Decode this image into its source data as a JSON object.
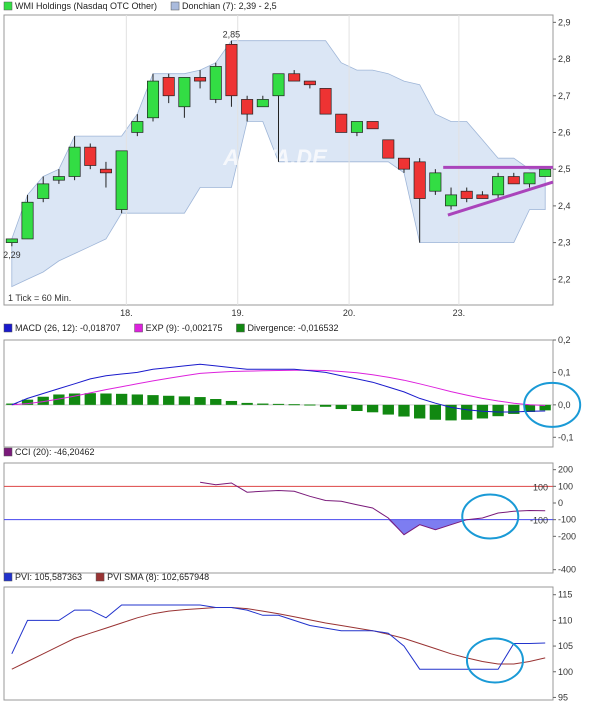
{
  "colors": {
    "up": "#33dd44",
    "down": "#ee3333",
    "band_fill": "#dbe6f5",
    "band_edge": "#9fb6d8",
    "trend": "#aa44bb",
    "macd": "#1a1acc",
    "exp": "#dd22dd",
    "divergence": "#118811",
    "cci": "#7a1a7a",
    "cci_fill": "#6666ee",
    "cci_ref_high": "#dd4444",
    "cci_ref_low": "#4444ee",
    "pvi": "#2233cc",
    "pvi_sma": "#993333",
    "highlight": "#1a9ad6"
  },
  "chart_data": [
    {
      "type": "candlestick",
      "legend": [
        {
          "text": "WMI Holdings (Nasdaq OTC Other)",
          "color": "#33dd44"
        },
        {
          "text": "Donchian (7): 2,39 - 2,5",
          "color": "#aabbdd"
        }
      ],
      "watermark": "ARIVA.DE",
      "note": "1 Tick = 60 Min.",
      "x_labels": [
        {
          "i": 7.3,
          "text": "18."
        },
        {
          "i": 14.4,
          "text": "19."
        },
        {
          "i": 21.5,
          "text": "20."
        },
        {
          "i": 28.5,
          "text": "23."
        }
      ],
      "y_ticks": [
        {
          "v": 2.9,
          "text": "2,9"
        },
        {
          "v": 2.8,
          "text": "2,8"
        },
        {
          "v": 2.7,
          "text": "2,7"
        },
        {
          "v": 2.6,
          "text": "2,6"
        },
        {
          "v": 2.5,
          "text": "2,5"
        },
        {
          "v": 2.4,
          "text": "2,4"
        },
        {
          "v": 2.3,
          "text": "2,3"
        },
        {
          "v": 2.2,
          "text": "2,2"
        }
      ],
      "ylim": [
        2.13,
        2.92
      ],
      "annotations": [
        {
          "i": 0,
          "v": 2.285,
          "text": "2,29",
          "pos": "below"
        },
        {
          "i": 14,
          "v": 2.85,
          "text": "2,85",
          "pos": "above"
        }
      ],
      "candles": [
        {
          "o": 2.3,
          "h": 2.31,
          "l": 2.29,
          "c": 2.31
        },
        {
          "o": 2.31,
          "h": 2.43,
          "l": 2.31,
          "c": 2.41
        },
        {
          "o": 2.42,
          "h": 2.48,
          "l": 2.41,
          "c": 2.46
        },
        {
          "o": 2.47,
          "h": 2.5,
          "l": 2.46,
          "c": 2.48
        },
        {
          "o": 2.48,
          "h": 2.59,
          "l": 2.47,
          "c": 2.56
        },
        {
          "o": 2.56,
          "h": 2.57,
          "l": 2.5,
          "c": 2.51
        },
        {
          "o": 2.5,
          "h": 2.52,
          "l": 2.45,
          "c": 2.49
        },
        {
          "o": 2.39,
          "h": 2.55,
          "l": 2.38,
          "c": 2.55
        },
        {
          "o": 2.6,
          "h": 2.65,
          "l": 2.59,
          "c": 2.63
        },
        {
          "o": 2.64,
          "h": 2.76,
          "l": 2.63,
          "c": 2.74
        },
        {
          "o": 2.75,
          "h": 2.76,
          "l": 2.68,
          "c": 2.7
        },
        {
          "o": 2.67,
          "h": 2.75,
          "l": 2.64,
          "c": 2.75
        },
        {
          "o": 2.75,
          "h": 2.77,
          "l": 2.72,
          "c": 2.74
        },
        {
          "o": 2.69,
          "h": 2.79,
          "l": 2.68,
          "c": 2.78
        },
        {
          "o": 2.84,
          "h": 2.85,
          "l": 2.67,
          "c": 2.7
        },
        {
          "o": 2.69,
          "h": 2.7,
          "l": 2.63,
          "c": 2.65
        },
        {
          "o": 2.67,
          "h": 2.7,
          "l": 2.67,
          "c": 2.69
        },
        {
          "o": 2.7,
          "h": 2.76,
          "l": 2.52,
          "c": 2.76
        },
        {
          "o": 2.76,
          "h": 2.77,
          "l": 2.74,
          "c": 2.74
        },
        {
          "o": 2.74,
          "h": 2.74,
          "l": 2.72,
          "c": 2.73
        },
        {
          "o": 2.72,
          "h": 2.72,
          "l": 2.65,
          "c": 2.65
        },
        {
          "o": 2.65,
          "h": 2.65,
          "l": 2.6,
          "c": 2.6
        },
        {
          "o": 2.6,
          "h": 2.63,
          "l": 2.59,
          "c": 2.63
        },
        {
          "o": 2.63,
          "h": 2.63,
          "l": 2.61,
          "c": 2.61
        },
        {
          "o": 2.58,
          "h": 2.58,
          "l": 2.53,
          "c": 2.53
        },
        {
          "o": 2.53,
          "h": 2.53,
          "l": 2.49,
          "c": 2.5
        },
        {
          "o": 2.52,
          "h": 2.53,
          "l": 2.3,
          "c": 2.42
        },
        {
          "o": 2.44,
          "h": 2.5,
          "l": 2.43,
          "c": 2.49
        },
        {
          "o": 2.4,
          "h": 2.45,
          "l": 2.39,
          "c": 2.43
        },
        {
          "o": 2.44,
          "h": 2.45,
          "l": 2.41,
          "c": 2.42
        },
        {
          "o": 2.43,
          "h": 2.44,
          "l": 2.42,
          "c": 2.42
        },
        {
          "o": 2.43,
          "h": 2.49,
          "l": 2.42,
          "c": 2.48
        },
        {
          "o": 2.48,
          "h": 2.49,
          "l": 2.46,
          "c": 2.46
        },
        {
          "o": 2.46,
          "h": 2.49,
          "l": 2.45,
          "c": 2.49
        },
        {
          "o": 2.48,
          "h": 2.5,
          "l": 2.48,
          "c": 2.5
        }
      ],
      "donchian": {
        "upper": [
          2.31,
          2.43,
          2.48,
          2.5,
          2.59,
          2.59,
          2.59,
          2.59,
          2.65,
          2.76,
          2.76,
          2.76,
          2.77,
          2.79,
          2.85,
          2.85,
          2.85,
          2.85,
          2.85,
          2.85,
          2.85,
          2.79,
          2.77,
          2.77,
          2.76,
          2.74,
          2.73,
          2.65,
          2.63,
          2.63,
          2.58,
          2.53,
          2.53,
          2.5,
          2.5
        ],
        "lower": [
          2.18,
          2.2,
          2.22,
          2.25,
          2.27,
          2.29,
          2.31,
          2.38,
          2.38,
          2.38,
          2.38,
          2.38,
          2.45,
          2.45,
          2.45,
          2.63,
          2.63,
          2.52,
          2.52,
          2.52,
          2.52,
          2.52,
          2.52,
          2.52,
          2.52,
          2.49,
          2.3,
          2.3,
          2.3,
          2.3,
          2.3,
          2.3,
          2.3,
          2.39,
          2.39
        ]
      },
      "trendlines": [
        {
          "i1": 27.5,
          "v1": 2.505,
          "i2": 34.5,
          "v2": 2.505
        },
        {
          "i1": 27.8,
          "v1": 2.375,
          "i2": 34.5,
          "v2": 2.465
        }
      ]
    },
    {
      "type": "line+bar",
      "legend": [
        {
          "text": "MACD (26, 12): -0,018707",
          "color": "#1a1acc"
        },
        {
          "text": "EXP (9): -0,002175",
          "color": "#dd22dd"
        },
        {
          "text": "Divergence: -0,016532",
          "color": "#118811"
        }
      ],
      "y_ticks": [
        {
          "v": 0.2,
          "text": "0,2"
        },
        {
          "v": 0.1,
          "text": "0,1"
        },
        {
          "v": 0.0,
          "text": "0,0"
        },
        {
          "v": -0.1,
          "text": "-0,1"
        }
      ],
      "ylim": [
        -0.13,
        0.2
      ],
      "macd": [
        0.0,
        0.02,
        0.035,
        0.05,
        0.065,
        0.08,
        0.09,
        0.095,
        0.1,
        0.11,
        0.115,
        0.12,
        0.125,
        0.12,
        0.115,
        0.11,
        0.11,
        0.11,
        0.11,
        0.105,
        0.1,
        0.09,
        0.08,
        0.07,
        0.055,
        0.04,
        0.02,
        0.005,
        -0.008,
        -0.015,
        -0.02,
        -0.022,
        -0.022,
        -0.02,
        -0.019
      ],
      "exp": [
        0.0,
        0.004,
        0.01,
        0.018,
        0.027,
        0.037,
        0.047,
        0.056,
        0.065,
        0.074,
        0.082,
        0.09,
        0.097,
        0.1,
        0.103,
        0.104,
        0.105,
        0.106,
        0.107,
        0.107,
        0.106,
        0.103,
        0.099,
        0.093,
        0.085,
        0.076,
        0.065,
        0.053,
        0.041,
        0.03,
        0.02,
        0.012,
        0.005,
        0.0,
        -0.002
      ],
      "divergence": [
        0.004,
        0.016,
        0.025,
        0.032,
        0.035,
        0.036,
        0.035,
        0.034,
        0.032,
        0.03,
        0.028,
        0.026,
        0.024,
        0.018,
        0.012,
        0.006,
        0.004,
        0.003,
        0.002,
        0.001,
        -0.006,
        -0.013,
        -0.019,
        -0.023,
        -0.03,
        -0.036,
        -0.042,
        -0.046,
        -0.048,
        -0.046,
        -0.042,
        -0.035,
        -0.028,
        -0.022,
        -0.017
      ],
      "highlight": {
        "i": 33.3,
        "v": 0.0
      }
    },
    {
      "type": "line",
      "legend": [
        {
          "text": "CCI (20): -46,20462",
          "color": "#7a1a7a"
        }
      ],
      "y_ticks": [
        {
          "v": 200,
          "text": "200"
        },
        {
          "v": 100,
          "text": "100"
        },
        {
          "v": 0,
          "text": "0"
        },
        {
          "v": -100,
          "text": "-100"
        },
        {
          "v": -200,
          "text": "-200"
        },
        {
          "v": -400,
          "text": "-400"
        }
      ],
      "ref_lines": [
        {
          "v": 100,
          "text": "100"
        },
        {
          "v": -100,
          "text": "-100"
        }
      ],
      "ylim": [
        -420,
        240
      ],
      "start": 12,
      "cci": [
        125,
        110,
        120,
        65,
        70,
        75,
        70,
        40,
        15,
        10,
        -10,
        -30,
        -90,
        -190,
        -130,
        -160,
        -130,
        -100,
        -90,
        -60,
        -50,
        -45,
        -46
      ],
      "highlight": {
        "i": 30.5,
        "v": -105
      }
    },
    {
      "type": "line",
      "legend": [
        {
          "text": "PVI: 105,587363",
          "color": "#2233cc"
        },
        {
          "text": "PVI SMA (8): 102,657948",
          "color": "#993333"
        }
      ],
      "y_ticks": [
        {
          "v": 115,
          "text": "115"
        },
        {
          "v": 110,
          "text": "110"
        },
        {
          "v": 105,
          "text": "105"
        },
        {
          "v": 100,
          "text": "100"
        },
        {
          "v": 95,
          "text": "95"
        }
      ],
      "ylim": [
        94.5,
        116.5
      ],
      "pvi": [
        103.5,
        110,
        110,
        110,
        112,
        112,
        110.5,
        113,
        113,
        113,
        113,
        113,
        113,
        112.5,
        112.5,
        112,
        111,
        111,
        110,
        109,
        108.5,
        108,
        108,
        108,
        107.5,
        105,
        100.5,
        100.5,
        100.5,
        100.5,
        100.5,
        100.5,
        105.5,
        105.5,
        105.6
      ],
      "pvi_sma": [
        100.5,
        102,
        103.5,
        105,
        106.5,
        107.5,
        108.5,
        109.5,
        110.5,
        111.3,
        111.8,
        112.1,
        112.3,
        112.5,
        112.5,
        112.3,
        111.8,
        111.3,
        110.7,
        110.1,
        109.5,
        109,
        108.5,
        108,
        107.3,
        106.5,
        105.5,
        104.5,
        103.5,
        102.7,
        102,
        101.5,
        101.5,
        102,
        102.7
      ],
      "highlight": {
        "i": 30.8,
        "v": 102.2
      }
    }
  ]
}
